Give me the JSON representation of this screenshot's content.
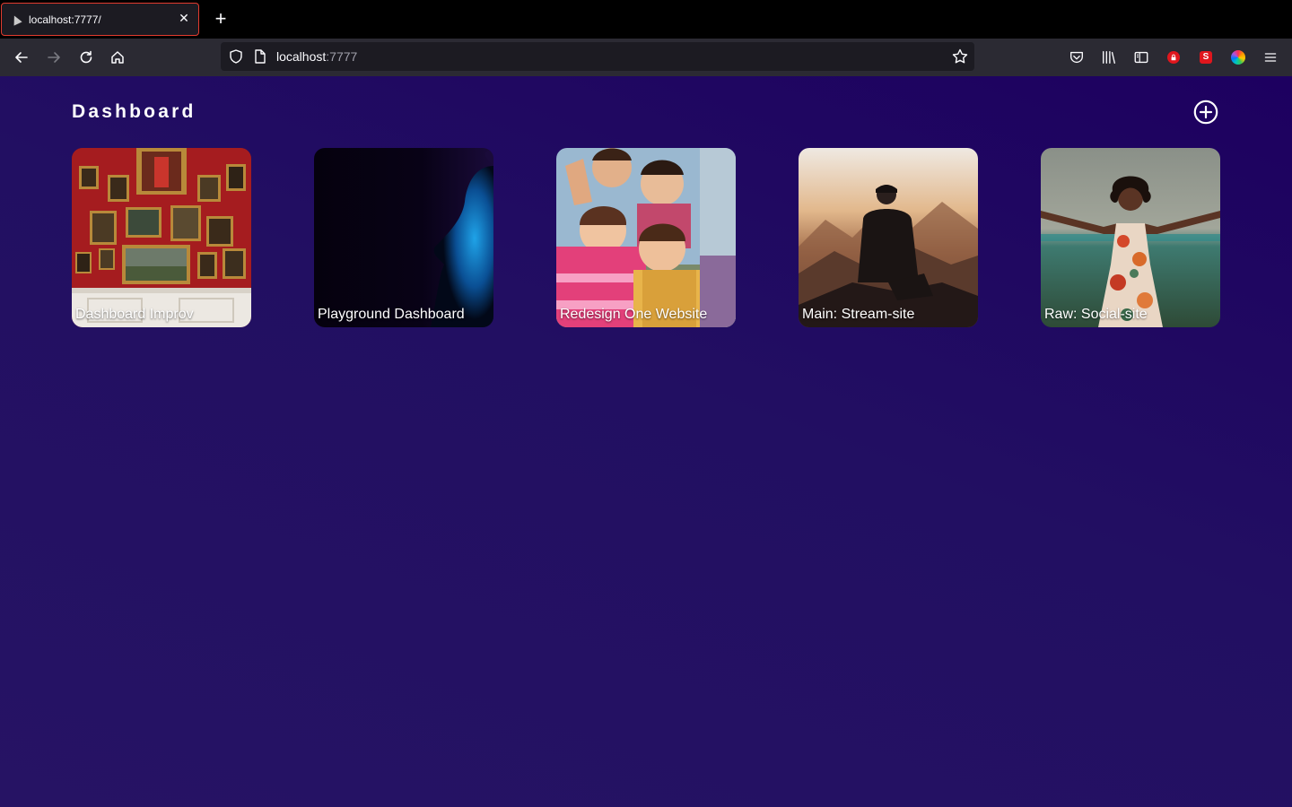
{
  "browser": {
    "tab": {
      "title": "localhost:7777/"
    },
    "url": {
      "host": "localhost",
      "port": ":7777"
    }
  },
  "page": {
    "title": "Dashboard",
    "cards": [
      {
        "label": "Dashboard Improv"
      },
      {
        "label": "Playground Dashboard"
      },
      {
        "label": "Redesign One Website"
      },
      {
        "label": "Main: Stream-site"
      },
      {
        "label": "Raw: Social-site"
      }
    ]
  },
  "colors": {
    "background": "#1f0e5e",
    "tab_border": "#e23b2e",
    "chrome": "#2b2a33"
  },
  "icons": {
    "toolbar": [
      "back-icon",
      "forward-icon",
      "reload-icon",
      "home-icon",
      "shield-icon",
      "page-icon",
      "bookmark-star-icon",
      "pocket-icon",
      "library-icon",
      "sidebar-icon",
      "lock-extension-icon",
      "s-extension-icon",
      "color-wheel-icon",
      "menu-icon"
    ],
    "page": [
      "add-circle-icon"
    ]
  }
}
